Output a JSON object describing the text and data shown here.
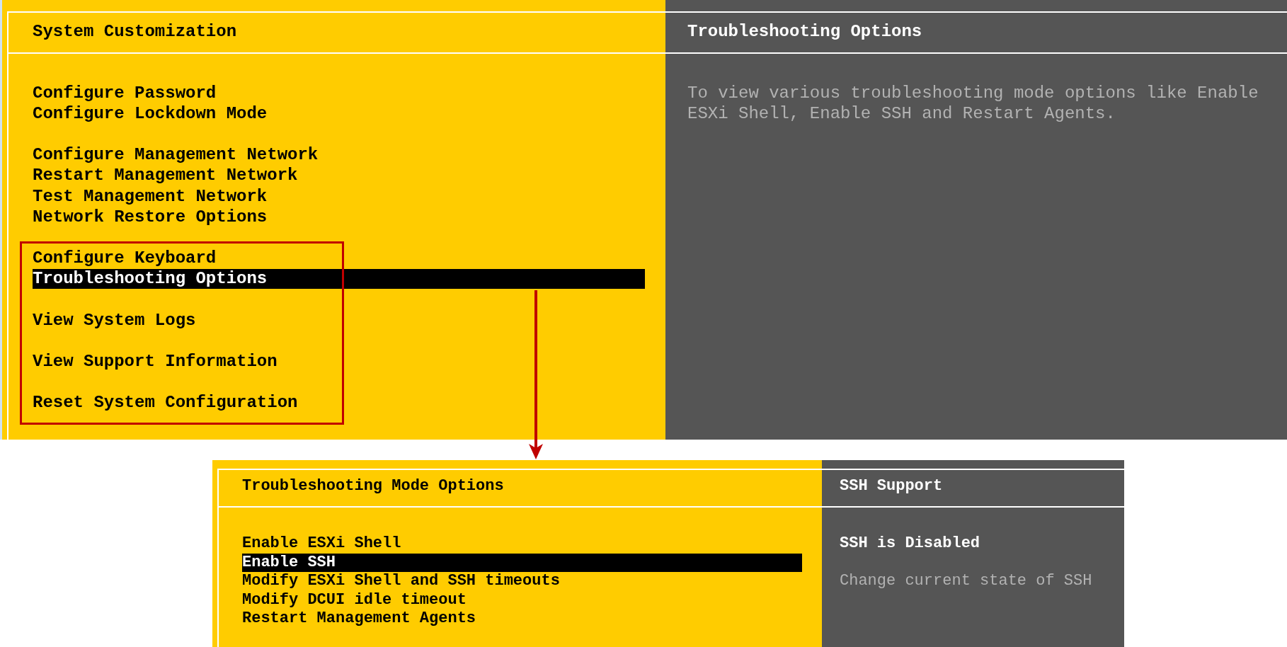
{
  "top_screen": {
    "menu": {
      "title": "System Customization",
      "groups": [
        {
          "items": [
            {
              "label": "Configure Password",
              "selected": false
            },
            {
              "label": "Configure Lockdown Mode",
              "selected": false
            }
          ]
        },
        {
          "items": [
            {
              "label": "Configure Management Network",
              "selected": false
            },
            {
              "label": "Restart Management Network",
              "selected": false
            },
            {
              "label": "Test Management Network",
              "selected": false
            },
            {
              "label": "Network Restore Options",
              "selected": false
            }
          ]
        },
        {
          "items": [
            {
              "label": "Configure Keyboard",
              "selected": false
            },
            {
              "label": "Troubleshooting Options",
              "selected": true
            }
          ]
        },
        {
          "items": [
            {
              "label": "View System Logs",
              "selected": false
            }
          ]
        },
        {
          "items": [
            {
              "label": "View Support Information",
              "selected": false
            }
          ]
        },
        {
          "items": [
            {
              "label": "Reset System Configuration",
              "selected": false
            }
          ]
        }
      ]
    },
    "detail": {
      "title": "Troubleshooting Options",
      "description": "To view various troubleshooting mode options like Enable ESXi Shell, Enable SSH and Restart Agents."
    }
  },
  "bottom_screen": {
    "menu": {
      "title": "Troubleshooting Mode Options",
      "items": [
        {
          "label": "Enable ESXi Shell",
          "selected": false
        },
        {
          "label": "Enable SSH",
          "selected": true
        },
        {
          "label": "Modify ESXi Shell and SSH timeouts",
          "selected": false
        },
        {
          "label": "Modify DCUI idle timeout",
          "selected": false
        },
        {
          "label": "Restart Management Agents",
          "selected": false
        }
      ]
    },
    "detail": {
      "title": "SSH Support",
      "status": "SSH is Disabled",
      "description": "Change current state of SSH"
    }
  }
}
